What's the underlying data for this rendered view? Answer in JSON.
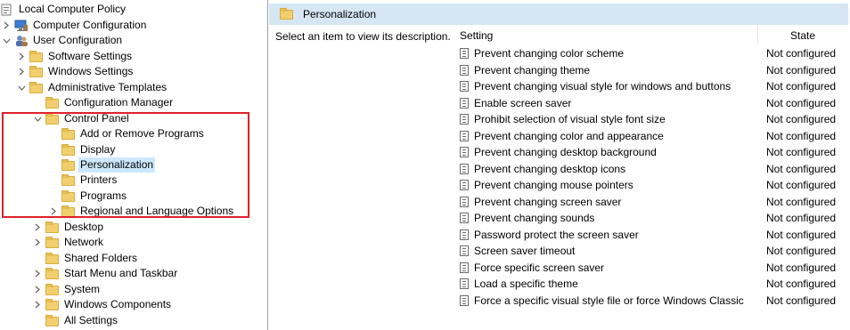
{
  "tree": {
    "items": [
      {
        "label": "Local Computer Policy"
      },
      {
        "label": "Computer Configuration"
      },
      {
        "label": "User Configuration"
      },
      {
        "label": "Software Settings"
      },
      {
        "label": "Windows Settings"
      },
      {
        "label": "Administrative Templates"
      },
      {
        "label": "Configuration Manager"
      },
      {
        "label": "Control Panel"
      },
      {
        "label": "Add or Remove Programs"
      },
      {
        "label": "Display"
      },
      {
        "label": "Personalization"
      },
      {
        "label": "Printers"
      },
      {
        "label": "Programs"
      },
      {
        "label": "Regional and Language Options"
      },
      {
        "label": "Desktop"
      },
      {
        "label": "Network"
      },
      {
        "label": "Shared Folders"
      },
      {
        "label": "Start Menu and Taskbar"
      },
      {
        "label": "System"
      },
      {
        "label": "Windows Components"
      },
      {
        "label": "All Settings"
      }
    ]
  },
  "right": {
    "header_title": "Personalization",
    "description": "Select an item to view its description.",
    "col_setting": "Setting",
    "col_state": "State",
    "rows": [
      {
        "name": "Prevent changing color scheme",
        "state": "Not configured"
      },
      {
        "name": "Prevent changing theme",
        "state": "Not configured"
      },
      {
        "name": "Prevent changing visual style for windows and buttons",
        "state": "Not configured"
      },
      {
        "name": "Enable screen saver",
        "state": "Not configured"
      },
      {
        "name": "Prohibit selection of visual style font size",
        "state": "Not configured"
      },
      {
        "name": "Prevent changing color and appearance",
        "state": "Not configured"
      },
      {
        "name": "Prevent changing desktop background",
        "state": "Not configured"
      },
      {
        "name": "Prevent changing desktop icons",
        "state": "Not configured"
      },
      {
        "name": "Prevent changing mouse pointers",
        "state": "Not configured"
      },
      {
        "name": "Prevent changing screen saver",
        "state": "Not configured"
      },
      {
        "name": "Prevent changing sounds",
        "state": "Not configured"
      },
      {
        "name": "Password protect the screen saver",
        "state": "Not configured"
      },
      {
        "name": "Screen saver timeout",
        "state": "Not configured"
      },
      {
        "name": "Force specific screen saver",
        "state": "Not configured"
      },
      {
        "name": "Load a specific theme",
        "state": "Not configured"
      },
      {
        "name": "Force a specific visual style file or force Windows Classic",
        "state": "Not configured"
      }
    ]
  },
  "colors": {
    "header_bg": "#d6e6f5",
    "selection_bg": "#cce8ff",
    "highlight_border": "#e0202a",
    "folder": "#f1cf6e"
  }
}
